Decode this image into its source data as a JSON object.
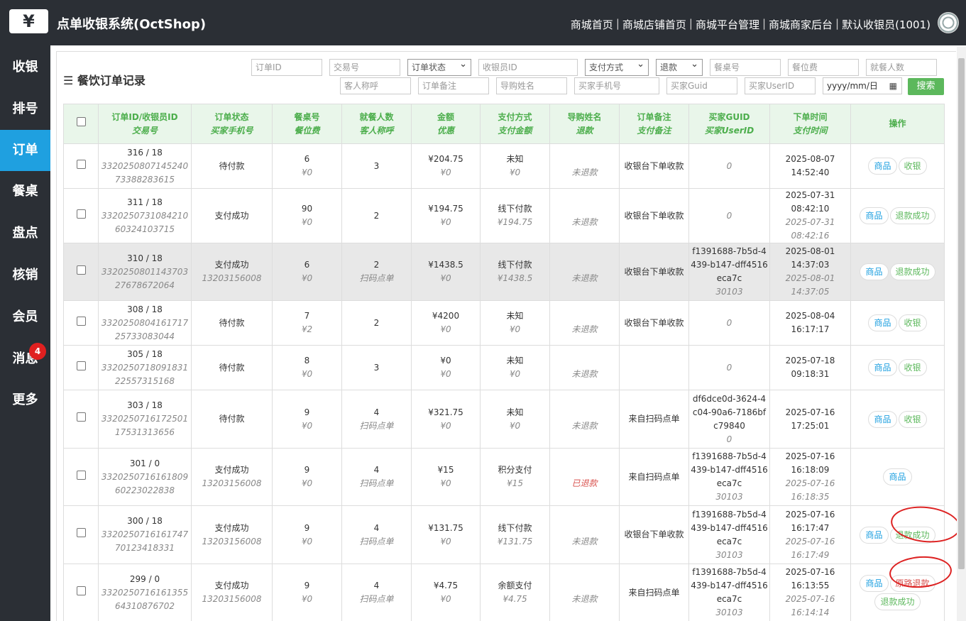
{
  "header": {
    "logo": "¥",
    "title": "点单收银系统(OctShop)",
    "nav": [
      "商城首页",
      "商城店铺首页",
      "商城平台管理",
      "商城商家后台",
      "默认收银员(1001)"
    ]
  },
  "sidebar": {
    "items": [
      "收银",
      "排号",
      "订单",
      "餐桌",
      "盘点",
      "核销",
      "会员",
      "消息",
      "更多"
    ],
    "badge": "4"
  },
  "panel": {
    "title": "餐饮订单记录",
    "search_label": "搜索",
    "filters": {
      "order_id": "订单ID",
      "trade_no": "交易号",
      "status": "订单状态",
      "cashier_id": "收银员ID",
      "pay_method": "支付方式",
      "refund": "退款",
      "table_no": "餐桌号",
      "seat_fee": "餐位费",
      "diners": "就餐人数",
      "guest_name": "客人称呼",
      "order_note": "订单备注",
      "guide_name": "导购姓名",
      "buyer_phone": "买家手机号",
      "buyer_guid": "买家Guid",
      "buyer_userid": "买家UserID",
      "date": "yyyy/mm/日"
    }
  },
  "table": {
    "headers": [
      [
        "订单ID/收银员ID",
        "交易号"
      ],
      [
        "订单状态",
        "买家手机号"
      ],
      [
        "餐桌号",
        "餐位费"
      ],
      [
        "就餐人数",
        "客人称呼"
      ],
      [
        "金额",
        "优惠"
      ],
      [
        "支付方式",
        "支付金额"
      ],
      [
        "导购姓名",
        "退款"
      ],
      [
        "订单备注",
        "支付备注"
      ],
      [
        "买家GUID",
        "买家UserID"
      ],
      [
        "下单时间",
        "支付时间"
      ],
      [
        "操作",
        ""
      ]
    ],
    "rows": [
      {
        "id": "316 / 18",
        "trade": "332025080714524073388283615",
        "status": "待付款",
        "phone": "",
        "table": "6",
        "seat": "¥0",
        "diners": "3",
        "guest": "",
        "amount": "¥204.75",
        "discount": "¥0",
        "pay": "未知",
        "paid": "¥0",
        "guide": "",
        "refund": "未退款",
        "note": "收银台下单收款",
        "guid": "",
        "uid": "0",
        "otime": "2025-08-07 14:52:40",
        "ptime": "",
        "btns": [
          {
            "t": "商品",
            "c": "blue"
          },
          {
            "t": "收银",
            "c": "green"
          }
        ]
      },
      {
        "id": "311 / 18",
        "trade": "332025073108421060324103715",
        "status": "支付成功",
        "phone": "",
        "table": "90",
        "seat": "¥0",
        "diners": "2",
        "guest": "",
        "amount": "¥194.75",
        "discount": "¥0",
        "pay": "线下付款",
        "paid": "¥194.75",
        "guide": "",
        "refund": "未退款",
        "note": "收银台下单收款",
        "guid": "",
        "uid": "0",
        "otime": "2025-07-31 08:42:10",
        "ptime": "2025-07-31 08:42:16",
        "btns": [
          {
            "t": "商品",
            "c": "blue"
          },
          {
            "t": "退款成功",
            "c": "green"
          }
        ]
      },
      {
        "id": "310 / 18",
        "trade": "332025080114370327678672064",
        "status": "支付成功",
        "phone": "13203156008",
        "table": "6",
        "seat": "¥0",
        "diners": "2",
        "guest": "扫码点单",
        "amount": "¥1438.5",
        "discount": "¥0",
        "pay": "线下付款",
        "paid": "¥1438.5",
        "guide": "",
        "refund": "未退款",
        "note": "收银台下单收款",
        "guid": "f1391688-7b5d-4439-b147-dff4516eca7c",
        "uid": "30103",
        "otime": "2025-08-01 14:37:03",
        "ptime": "2025-08-01 14:37:05",
        "btns": [
          {
            "t": "商品",
            "c": "blue"
          },
          {
            "t": "退款成功",
            "c": "green"
          }
        ]
      },
      {
        "id": "308 / 18",
        "trade": "332025080416171725733083044",
        "status": "待付款",
        "phone": "",
        "table": "7",
        "seat": "¥2",
        "diners": "2",
        "guest": "",
        "amount": "¥4200",
        "discount": "¥0",
        "pay": "未知",
        "paid": "¥0",
        "guide": "",
        "refund": "未退款",
        "note": "收银台下单收款",
        "guid": "",
        "uid": "0",
        "otime": "2025-08-04 16:17:17",
        "ptime": "",
        "btns": [
          {
            "t": "商品",
            "c": "blue"
          },
          {
            "t": "收银",
            "c": "green"
          }
        ]
      },
      {
        "id": "305 / 18",
        "trade": "332025071809183122557315168",
        "status": "待付款",
        "phone": "",
        "table": "8",
        "seat": "¥0",
        "diners": "3",
        "guest": "",
        "amount": "¥0",
        "discount": "¥0",
        "pay": "未知",
        "paid": "¥0",
        "guide": "",
        "refund": "未退款",
        "note": "",
        "guid": "",
        "uid": "0",
        "otime": "2025-07-18 09:18:31",
        "ptime": "",
        "btns": [
          {
            "t": "商品",
            "c": "blue"
          },
          {
            "t": "收银",
            "c": "green"
          }
        ]
      },
      {
        "id": "303 / 18",
        "trade": "332025071617250117531313656",
        "status": "待付款",
        "phone": "",
        "table": "9",
        "seat": "¥0",
        "diners": "4",
        "guest": "扫码点单",
        "amount": "¥321.75",
        "discount": "¥0",
        "pay": "未知",
        "paid": "¥0",
        "guide": "",
        "refund": "未退款",
        "note": "来自扫码点单",
        "guid": "df6dce0d-3624-4c04-90a6-7186bfc79840",
        "uid": "0",
        "otime": "2025-07-16 17:25:01",
        "ptime": "",
        "btns": [
          {
            "t": "商品",
            "c": "blue"
          },
          {
            "t": "收银",
            "c": "green"
          }
        ]
      },
      {
        "id": "301 / 0",
        "trade": "332025071616180960223022838",
        "status": "支付成功",
        "phone": "13203156008",
        "table": "9",
        "seat": "¥0",
        "diners": "4",
        "guest": "扫码点单",
        "amount": "¥15",
        "discount": "¥0",
        "pay": "积分支付",
        "paid": "¥15",
        "guide": "",
        "refund": "已退款",
        "note": "来自扫码点单",
        "guid": "f1391688-7b5d-4439-b147-dff4516eca7c",
        "uid": "30103",
        "otime": "2025-07-16 16:18:09",
        "ptime": "2025-07-16 16:18:35",
        "btns": [
          {
            "t": "商品",
            "c": "blue"
          }
        ]
      },
      {
        "id": "300 / 18",
        "trade": "332025071616174770123418331",
        "status": "支付成功",
        "phone": "13203156008",
        "table": "9",
        "seat": "¥0",
        "diners": "4",
        "guest": "扫码点单",
        "amount": "¥131.75",
        "discount": "¥0",
        "pay": "线下付款",
        "paid": "¥131.75",
        "guide": "",
        "refund": "未退款",
        "note": "收银台下单收款",
        "guid": "f1391688-7b5d-4439-b147-dff4516eca7c",
        "uid": "30103",
        "otime": "2025-07-16 16:17:47",
        "ptime": "2025-07-16 16:17:49",
        "btns": [
          {
            "t": "商品",
            "c": "blue"
          },
          {
            "t": "退款成功",
            "c": "green"
          }
        ]
      },
      {
        "id": "299 / 0",
        "trade": "332025071616135564310876702",
        "status": "支付成功",
        "phone": "13203156008",
        "table": "9",
        "seat": "¥0",
        "diners": "4",
        "guest": "扫码点单",
        "amount": "¥4.75",
        "discount": "¥0",
        "pay": "余额支付",
        "paid": "¥4.75",
        "guide": "",
        "refund": "未退款",
        "note": "来自扫码点单",
        "guid": "f1391688-7b5d-4439-b147-dff4516eca7c",
        "uid": "30103",
        "otime": "2025-07-16 16:13:55",
        "ptime": "2025-07-16 16:14:14",
        "btns": [
          {
            "t": "商品",
            "c": "blue"
          },
          {
            "t": "原路退款",
            "c": "red"
          },
          {
            "t": "退款成功",
            "c": "green"
          }
        ]
      }
    ],
    "partial_row_guid": "f1391688-7b5d-443"
  }
}
